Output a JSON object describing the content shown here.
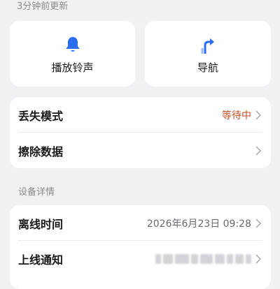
{
  "header": {
    "updated_text": "3分钟前更新"
  },
  "actions": {
    "ring": {
      "label": "播放铃声",
      "icon": "bell-icon"
    },
    "nav": {
      "label": "导航",
      "icon": "turn-arrow-icon"
    }
  },
  "security": {
    "lost_mode": {
      "title": "丢失模式",
      "status": "等待中"
    },
    "erase": {
      "title": "擦除数据"
    }
  },
  "details": {
    "section_title": "设备详情",
    "offline_time": {
      "title": "离线时间",
      "value": "2026年6月23日 09:28"
    },
    "online_notify": {
      "title": "上线通知"
    }
  },
  "colors": {
    "accent": "#2a6df0",
    "warning": "#c1502a",
    "background": "#f1f1f3",
    "card": "#ffffff"
  }
}
